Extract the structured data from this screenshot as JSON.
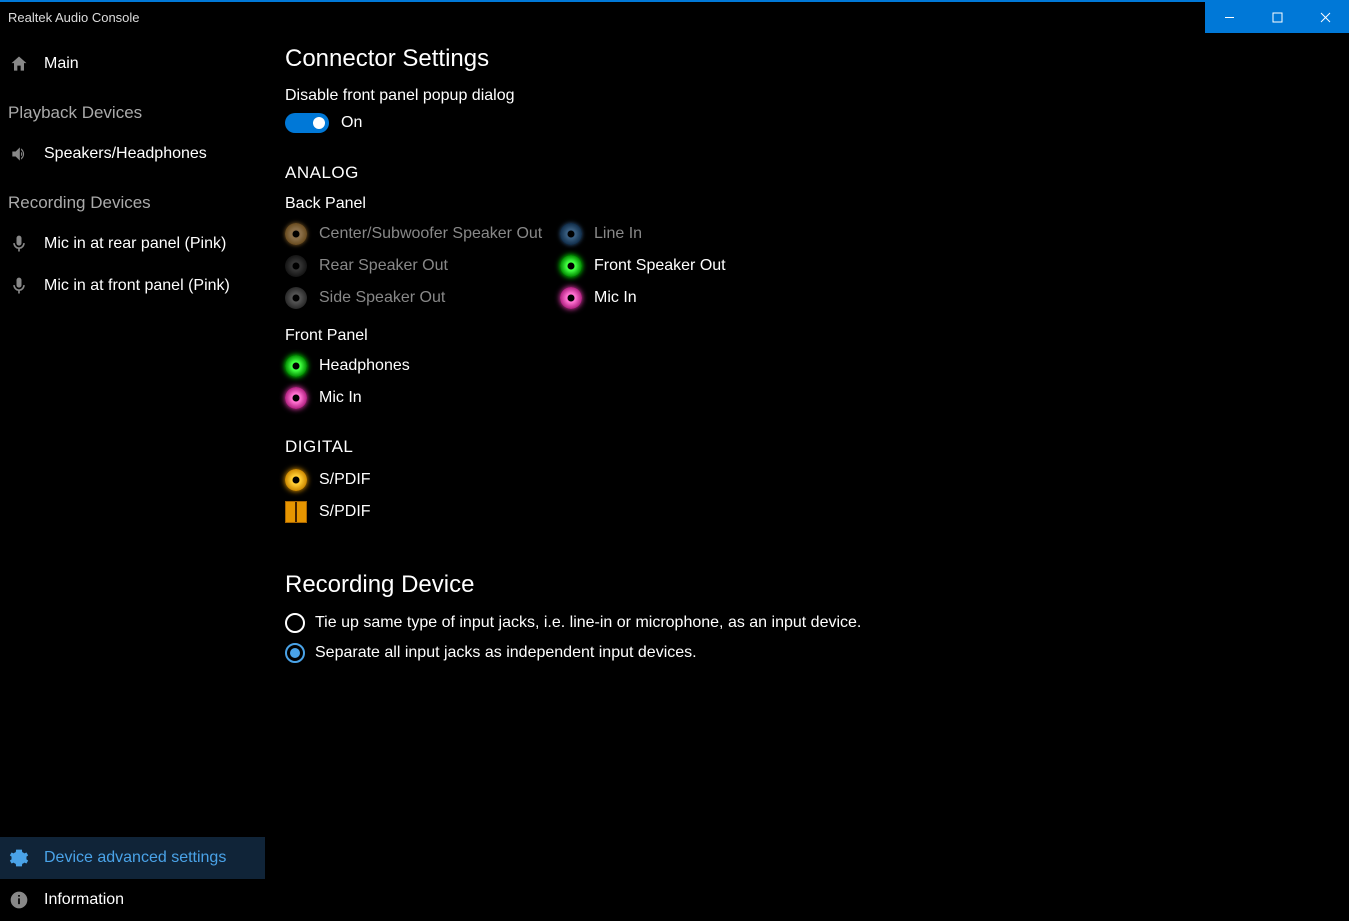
{
  "window": {
    "title": "Realtek Audio Console"
  },
  "sidebar": {
    "main_label": "Main",
    "playback_header": "Playback Devices",
    "speakers_label": "Speakers/Headphones",
    "recording_header": "Recording Devices",
    "mic_rear_label": "Mic in at rear panel (Pink)",
    "mic_front_label": "Mic in at front panel (Pink)",
    "advanced_label": "Device advanced settings",
    "information_label": "Information"
  },
  "connector": {
    "title": "Connector Settings",
    "disable_popup_label": "Disable front panel popup dialog",
    "toggle_state": "On",
    "analog_header": "ANALOG",
    "back_panel_header": "Back Panel",
    "back_jacks_left": [
      {
        "label": "Center/Subwoofer Speaker Out",
        "color": "orange",
        "active": false
      },
      {
        "label": "Rear Speaker Out",
        "color": "black",
        "active": false
      },
      {
        "label": "Side Speaker Out",
        "color": "grey",
        "active": false
      }
    ],
    "back_jacks_right": [
      {
        "label": "Line In",
        "color": "blue",
        "active": false
      },
      {
        "label": "Front Speaker Out",
        "color": "green",
        "active": true
      },
      {
        "label": "Mic In",
        "color": "pink",
        "active": true
      }
    ],
    "front_panel_header": "Front Panel",
    "front_jacks": [
      {
        "label": "Headphones",
        "color": "green",
        "active": true
      },
      {
        "label": "Mic In",
        "color": "pink",
        "active": true
      }
    ],
    "digital_header": "DIGITAL",
    "digital_jacks": [
      {
        "label": "S/PDIF",
        "type": "coax"
      },
      {
        "label": "S/PDIF",
        "type": "optical"
      }
    ]
  },
  "recording": {
    "title": "Recording Device",
    "option_tie": "Tie up same type of input jacks, i.e. line-in or microphone, as an input device.",
    "option_separate": "Separate all input jacks as independent input devices.",
    "selected": "separate"
  }
}
